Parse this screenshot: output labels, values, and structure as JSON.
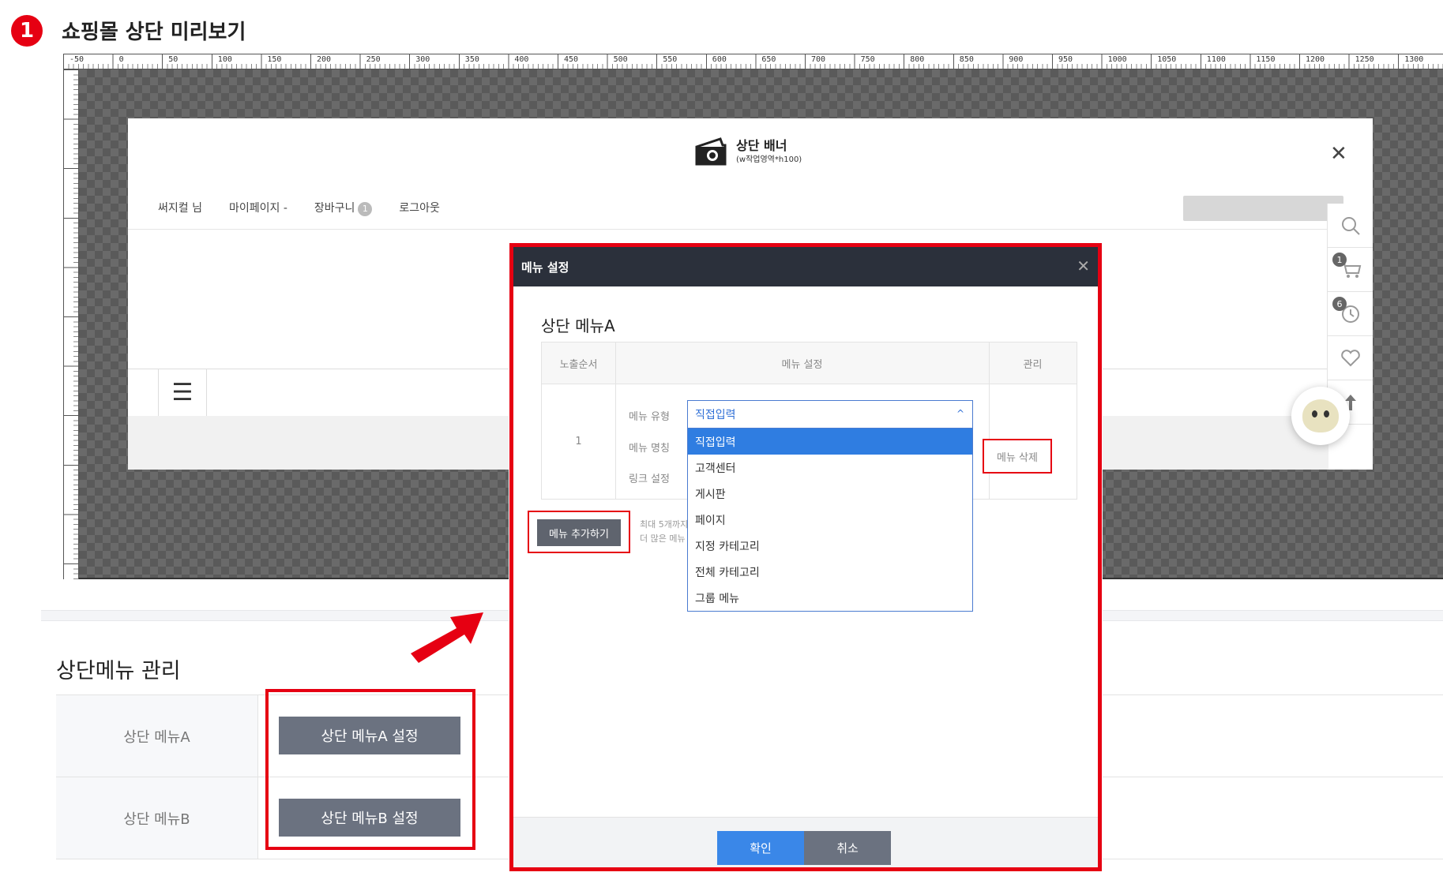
{
  "header": {
    "step": "1",
    "title": "쇼핑몰 상단 미리보기"
  },
  "ruler": {
    "ticks": [
      "-50",
      "0",
      "50",
      "100",
      "150",
      "200",
      "250",
      "300",
      "350",
      "400",
      "450",
      "500",
      "550",
      "600",
      "650",
      "700",
      "750",
      "800",
      "850",
      "900",
      "950",
      "1000",
      "1050",
      "1100",
      "1150",
      "1200",
      "1250",
      "1300"
    ]
  },
  "shop": {
    "banner_title": "상단 배너",
    "banner_sub": "(w작업영역*h100)",
    "nav": {
      "user": "써지컬 님",
      "mypage": "마이페이지 -",
      "cart": "장바구니",
      "cart_count": "1",
      "logout": "로그아웃"
    },
    "quick": {
      "cart_count": "1",
      "recent_count": "6"
    }
  },
  "management": {
    "title": "상단메뉴 관리",
    "rows": [
      {
        "label": "상단 메뉴A",
        "button": "상단 메뉴A 설정"
      },
      {
        "label": "상단 메뉴B",
        "button": "상단 메뉴B 설정"
      }
    ]
  },
  "modal": {
    "title": "메뉴 설정",
    "section": "상단 메뉴A",
    "columns": {
      "order": "노출순서",
      "setting": "메뉴 설정",
      "manage": "관리"
    },
    "row": {
      "order": "1",
      "type_label": "메뉴 유형",
      "name_label": "메뉴 명칭",
      "link_label": "링크 설정",
      "type_value": "직접입력",
      "options": [
        "직접입력",
        "고객센터",
        "게시판",
        "페이지",
        "지정 카테고리",
        "전체 카테고리",
        "그룹 메뉴"
      ],
      "delete": "메뉴 삭제"
    },
    "add_button": "메뉴 추가하기",
    "help": [
      "최대 5개까지",
      "더 많은 메뉴"
    ],
    "ok": "확인",
    "cancel": "취소"
  },
  "colors": {
    "accent_red": "#e60012",
    "primary_blue": "#3a87e8",
    "header_dark": "#2b303b"
  }
}
